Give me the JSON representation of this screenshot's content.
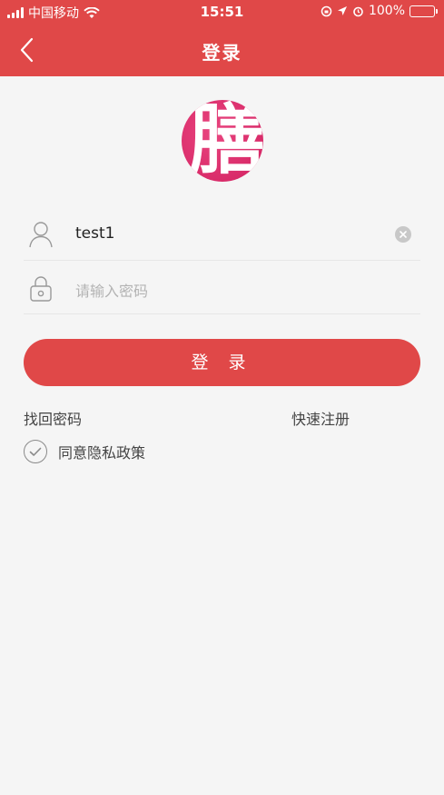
{
  "status_bar": {
    "carrier": "中国移动",
    "time": "15:51",
    "battery_text": "100%"
  },
  "nav": {
    "title": "登录"
  },
  "logo": {
    "char": "膳"
  },
  "form": {
    "username": {
      "value": "test1",
      "icon": "user-icon"
    },
    "password": {
      "placeholder": "请输入密码",
      "icon": "lock-icon"
    },
    "login_label": "登 录"
  },
  "links": {
    "forgot_password": "找回密码",
    "quick_register": "快速注册"
  },
  "agreement": {
    "label": "同意隐私政策"
  },
  "colors": {
    "primary": "#e04848",
    "logo": "#d92c6a",
    "background": "#f5f5f5"
  }
}
